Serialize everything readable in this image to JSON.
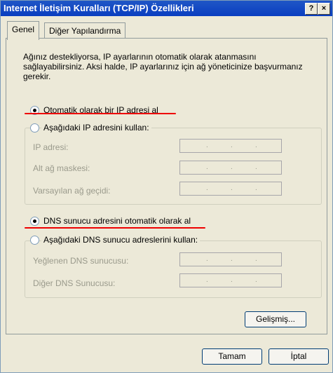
{
  "title": "Internet İletişim Kuralları (TCP/IP) Özellikleri",
  "help_label": "?",
  "close_label": "×",
  "tabs": [
    "Genel",
    "Diğer Yapılandırma"
  ],
  "description": "Ağınız destekliyorsa, IP ayarlarının otomatik olarak atanmasını sağlayabilirsiniz. Aksi halde, IP ayarlarınız için ağ yöneticinize başvurmanız gerekir.",
  "ip": {
    "auto_label": "Otomatik olarak bir IP adresi al",
    "auto_selected": true,
    "manual_label": "Aşağıdaki IP adresini kullan:",
    "fields": [
      "IP adresi:",
      "Alt ağ maskesi:",
      "Varsayılan ağ geçidi:"
    ]
  },
  "dns": {
    "auto_label": "DNS sunucu adresini otomatik olarak al",
    "auto_selected": true,
    "manual_label": "Aşağıdaki DNS sunucu adreslerini kullan:",
    "fields": [
      "Yeğlenen DNS sunucusu:",
      "Diğer DNS Sunucusu:"
    ]
  },
  "ip_dot": ".",
  "buttons": {
    "advanced": "Gelişmiş...",
    "ok": "Tamam",
    "cancel": "İptal"
  },
  "colors": {
    "title_bar": "#0a3ec0",
    "highlight_line": "#e00000",
    "window": "#ece9d8"
  }
}
